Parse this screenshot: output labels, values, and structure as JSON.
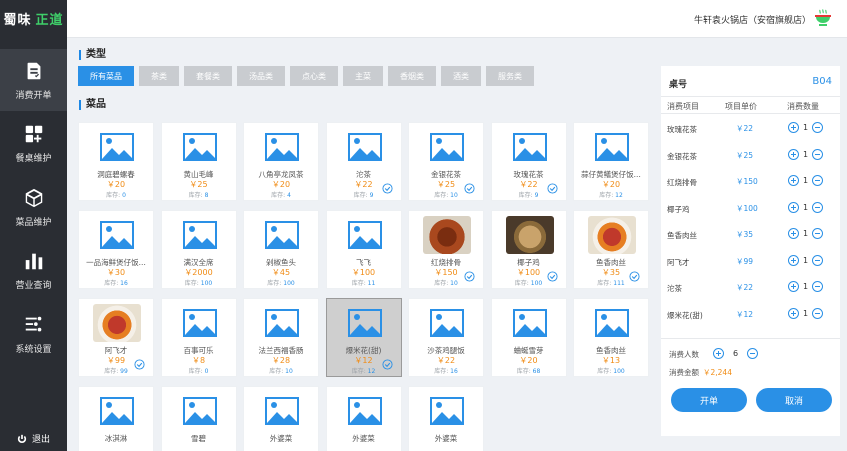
{
  "brand": {
    "part1": "蜀味",
    "part2": "正道"
  },
  "store_name": "牛轩袁火锅店（安宿旗舰店）",
  "nav": [
    {
      "label": "消费开单",
      "icon": "order-icon",
      "active": true
    },
    {
      "label": "餐桌维护",
      "icon": "table-grid-icon",
      "active": false
    },
    {
      "label": "菜品维护",
      "icon": "cube-icon",
      "active": false
    },
    {
      "label": "营业查询",
      "icon": "bar-chart-icon",
      "active": false
    },
    {
      "label": "系统设置",
      "icon": "settings-list-icon",
      "active": false
    }
  ],
  "logout": "退出",
  "category_title": "类型",
  "categories": [
    {
      "label": "所有菜品",
      "active": true
    },
    {
      "label": "茶类"
    },
    {
      "label": "套餐类"
    },
    {
      "label": "汤品类"
    },
    {
      "label": "点心类"
    },
    {
      "label": "主菜"
    },
    {
      "label": "香烟类"
    },
    {
      "label": "酒类"
    },
    {
      "label": "服务类"
    }
  ],
  "dish_title": "菜品",
  "stock_label": "库存:",
  "dishes": [
    {
      "name": "洞庭碧螺春",
      "price": "￥20",
      "stock": "0",
      "photo": false,
      "checked": false
    },
    {
      "name": "黄山毛峰",
      "price": "￥25",
      "stock": "8",
      "photo": false,
      "checked": false
    },
    {
      "name": "八角亭龙凤茶",
      "price": "￥20",
      "stock": "4",
      "photo": false,
      "checked": false
    },
    {
      "name": "沱茶",
      "price": "￥22",
      "stock": "9",
      "photo": false,
      "checked": true
    },
    {
      "name": "金银花茶",
      "price": "￥25",
      "stock": "10",
      "photo": false,
      "checked": true
    },
    {
      "name": "玫瑰花茶",
      "price": "￥22",
      "stock": "9",
      "photo": false,
      "checked": true
    },
    {
      "name": "蒜仔黄鳝煲仔饭...",
      "price": "￥20",
      "stock": "12",
      "photo": false,
      "checked": false
    },
    {
      "name": "一品海鲜煲仔饭...",
      "price": "￥30",
      "stock": "16",
      "photo": false,
      "checked": false
    },
    {
      "name": "满汉全席",
      "price": "￥2000",
      "stock": "100",
      "photo": false,
      "checked": false
    },
    {
      "name": "剁椒鱼头",
      "price": "￥45",
      "stock": "100",
      "photo": false,
      "checked": false
    },
    {
      "name": "飞飞",
      "price": "￥100",
      "stock": "11",
      "photo": false,
      "checked": false
    },
    {
      "name": "红烧排骨",
      "price": "￥150",
      "stock": "10",
      "photo": "ribs",
      "checked": true
    },
    {
      "name": "椰子鸡",
      "price": "￥100",
      "stock": "100",
      "photo": "chicken",
      "checked": true
    },
    {
      "name": "鱼香肉丝",
      "price": "￥35",
      "stock": "111",
      "photo": "pork",
      "checked": true
    },
    {
      "name": "阿飞才",
      "price": "￥99",
      "stock": "99",
      "photo": "pork",
      "checked": true
    },
    {
      "name": "百事可乐",
      "price": "￥8",
      "stock": "0",
      "photo": false,
      "checked": false
    },
    {
      "name": "法兰西福香肠",
      "price": "￥28",
      "stock": "10",
      "photo": false,
      "checked": false
    },
    {
      "name": "爆米花(甜)",
      "price": "￥12",
      "stock": "12",
      "photo": false,
      "checked": true,
      "selected": true
    },
    {
      "name": "沙茶鸡腿饭",
      "price": "￥22",
      "stock": "16",
      "photo": false,
      "checked": false
    },
    {
      "name": "蛐蜒雪芽",
      "price": "￥20",
      "stock": "68",
      "photo": false,
      "checked": false
    },
    {
      "name": "鱼香肉丝",
      "price": "￥13",
      "stock": "100",
      "photo": false,
      "checked": false
    },
    {
      "name": "冰淇淋",
      "price": "",
      "stock": "",
      "photo": false,
      "checked": false
    },
    {
      "name": "雪碧",
      "price": "",
      "stock": "",
      "photo": false,
      "checked": false
    },
    {
      "name": "外婆菜",
      "price": "",
      "stock": "",
      "photo": false,
      "checked": false
    },
    {
      "name": "外婆菜",
      "price": "",
      "stock": "",
      "photo": false,
      "checked": false
    },
    {
      "name": "外婆菜",
      "price": "",
      "stock": "",
      "photo": false,
      "checked": false
    }
  ],
  "order": {
    "table_label": "桌号",
    "table_value": "B04",
    "col_item": "消费项目",
    "col_price": "项目单价",
    "col_qty": "消费数量",
    "items": [
      {
        "name": "玫瑰花茶",
        "price": "￥22",
        "qty": "1"
      },
      {
        "name": "金银花茶",
        "price": "￥25",
        "qty": "1"
      },
      {
        "name": "红烧排骨",
        "price": "￥150",
        "qty": "1"
      },
      {
        "name": "椰子鸡",
        "price": "￥100",
        "qty": "1"
      },
      {
        "name": "鱼香肉丝",
        "price": "￥35",
        "qty": "1"
      },
      {
        "name": "阿飞才",
        "price": "￥99",
        "qty": "1"
      },
      {
        "name": "沱茶",
        "price": "￥22",
        "qty": "1"
      },
      {
        "name": "爆米花(甜)",
        "price": "￥12",
        "qty": "1"
      }
    ],
    "people_label": "消费人数",
    "people_value": "6",
    "amount_label": "消费金额",
    "amount_value": "￥2,244",
    "open_button": "开单",
    "cancel_button": "取消"
  },
  "colors": {
    "accent": "#2a90e6",
    "price": "#f08c16",
    "sidebar": "#2a2d33",
    "brand_green": "#3fcf6a"
  }
}
